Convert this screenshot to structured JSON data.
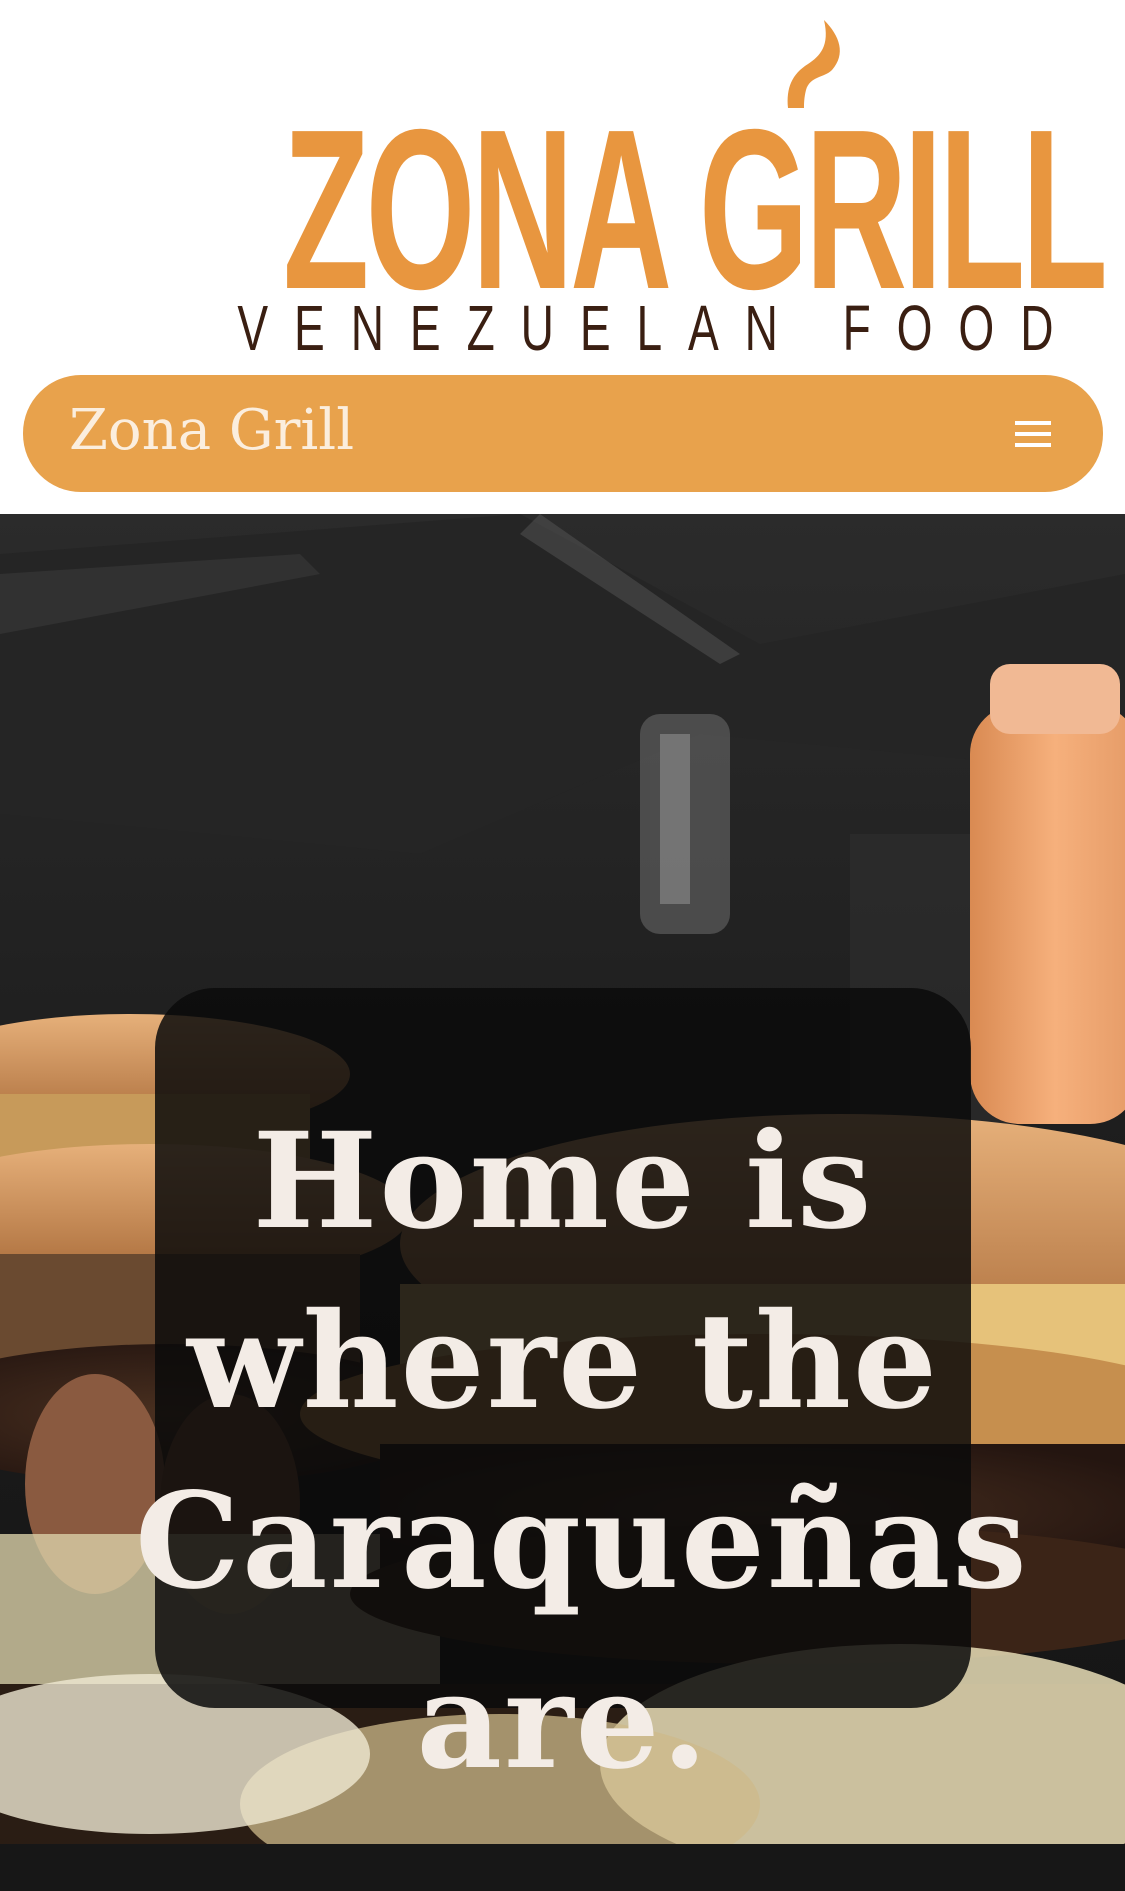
{
  "logo": {
    "title": "ZONA GRILL",
    "subtitle": "VENEZUELAN FOOD"
  },
  "navbar": {
    "brand": "Zona Grill",
    "menu_icon": "hamburger-menu-icon"
  },
  "hero": {
    "headline": "Home is where the Caraqueñas are."
  },
  "colors": {
    "brand_orange": "#e8963f",
    "nav_orange": "#e8a24c",
    "brand_brown": "#3a1f12",
    "overlay": "#0a0a0a"
  }
}
